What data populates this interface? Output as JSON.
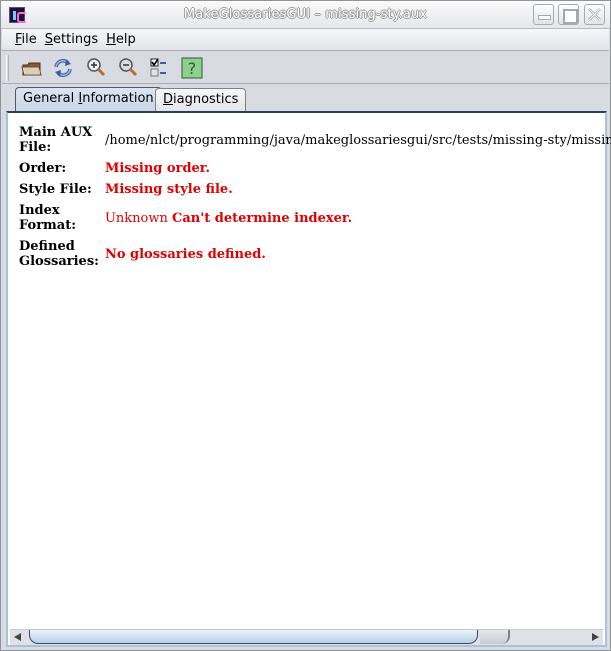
{
  "window": {
    "title": "MakeGlossariesGUI – missing-sty.aux",
    "controls": [
      "minimize",
      "maximize",
      "close"
    ]
  },
  "menubar": {
    "items": [
      {
        "label_rest": "ile",
        "mnemonic": "F",
        "label": "File"
      },
      {
        "label_rest": "ettings",
        "mnemonic": "S",
        "label": "Settings"
      },
      {
        "label_rest": "elp",
        "mnemonic": "H",
        "label": "Help"
      }
    ]
  },
  "toolbar": {
    "buttons": [
      {
        "icon": "open-folder-icon",
        "tooltip": "Open"
      },
      {
        "icon": "reload-icon",
        "tooltip": "Reload"
      },
      {
        "icon": "zoom-in-icon",
        "tooltip": "Zoom in"
      },
      {
        "icon": "zoom-out-icon",
        "tooltip": "Zoom out"
      },
      {
        "icon": "settings-checklist-icon",
        "tooltip": "Settings"
      },
      {
        "icon": "help-icon",
        "tooltip": "Help"
      }
    ]
  },
  "tabs": [
    {
      "pre": "General ",
      "mnemonic": "I",
      "post": "nformation",
      "active": true
    },
    {
      "pre": "",
      "mnemonic": "D",
      "post": "iagnostics",
      "active": false
    }
  ],
  "info": {
    "main_aux": {
      "label": "Main AUX File:",
      "label_line1": "Main AUX",
      "label_line2": "File:",
      "value": "/home/nlct/programming/java/makeglossariesgui/src/tests/missing-sty/missing-sty"
    },
    "order": {
      "label": "Order:",
      "value": "Missing order."
    },
    "style_file": {
      "label": "Style File:",
      "value": "Missing style file."
    },
    "index_format": {
      "label": "Index Format:",
      "label_line1": "Index",
      "label_line2": "Format:",
      "value_plain": "Unknown",
      "value_bold": "Can't determine indexer."
    },
    "defined_glossaries": {
      "label": "Defined Glossaries:",
      "label_line1": "Defined",
      "label_line2": "Glossaries:",
      "value": "No glossaries defined."
    }
  },
  "colors": {
    "error_text": "#e00000",
    "active_tab": "#c9d6e6"
  }
}
